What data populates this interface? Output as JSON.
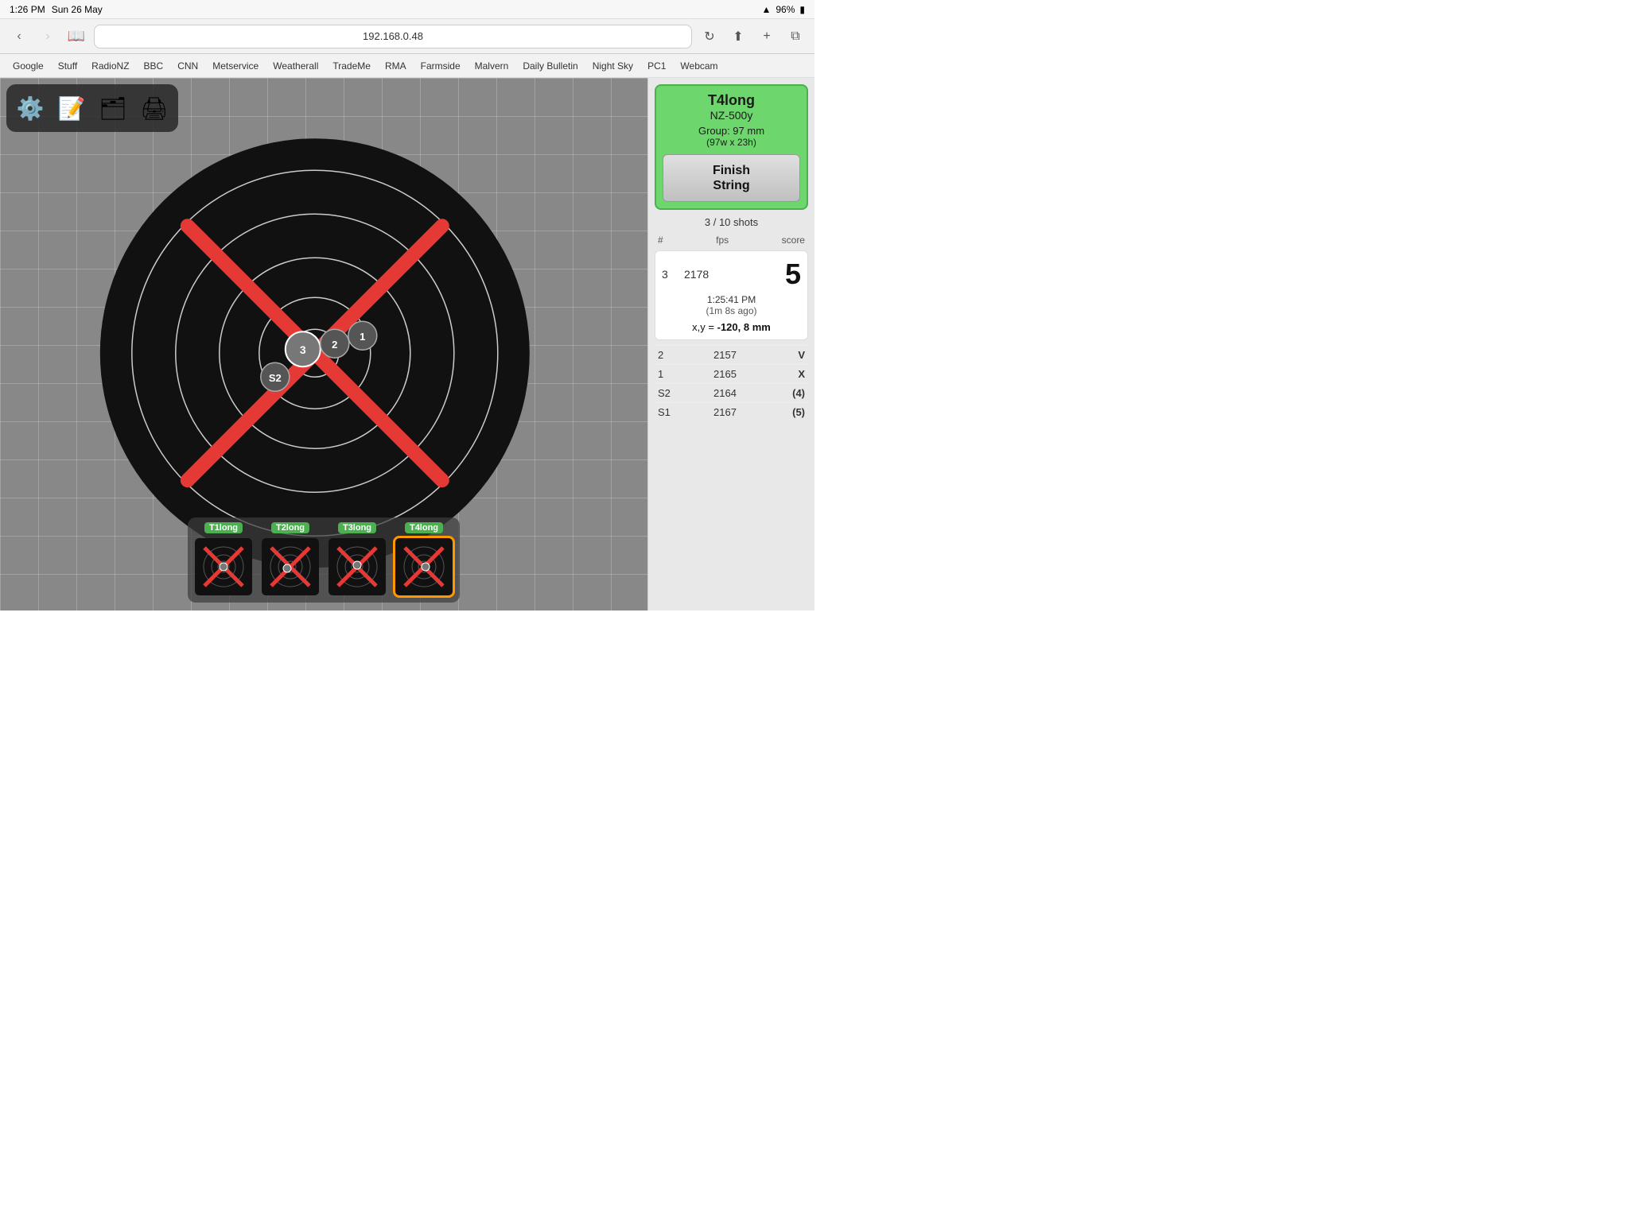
{
  "status_bar": {
    "time": "1:26 PM",
    "date": "Sun 26 May",
    "wifi_icon": "wifi",
    "battery": "96%",
    "battery_icon": "battery"
  },
  "browser": {
    "address": "192.168.0.48",
    "refresh_icon": "↻",
    "back_icon": "‹",
    "forward_icon": "›",
    "bookmarks_icon": "📖",
    "share_icon": "⬆",
    "new_tab_icon": "+",
    "tabs_icon": "⧉"
  },
  "bookmarks": [
    "Google",
    "Stuff",
    "RadioNZ",
    "BBC",
    "CNN",
    "Metservice",
    "Weatherall",
    "TradeMe",
    "RMA",
    "Farmside",
    "Malvern",
    "Daily Bulletin",
    "Night Sky",
    "PC1",
    "Webcam"
  ],
  "toolbar": {
    "settings_icon": "⚙",
    "notes_icon": "📝",
    "files_icon": "🗂",
    "print_icon": "🖨"
  },
  "target_info": {
    "name": "T4long",
    "distance": "NZ-500y",
    "group_label": "Group: 97 mm",
    "group_detail": "(97w x 23h)",
    "finish_string": "Finish\nString",
    "shots_count": "3 / 10 shots"
  },
  "shots_header": {
    "num": "#",
    "fps": "fps",
    "score": "score"
  },
  "current_shot": {
    "num": 3,
    "fps": 2178,
    "score": "5",
    "time": "1:25:41 PM",
    "ago": "(1m 8s ago)",
    "xy_label": "x,y =",
    "xy_value": "-120, 8 mm"
  },
  "history": [
    {
      "num": 2,
      "fps": 2157,
      "score": "V"
    },
    {
      "num": 1,
      "fps": 2165,
      "score": "X"
    },
    {
      "num": "S2",
      "fps": 2164,
      "score": "(4)"
    },
    {
      "num": "S1",
      "fps": 2167,
      "score": "(5)"
    }
  ],
  "thumbnails": [
    {
      "label": "T1long",
      "active": false
    },
    {
      "label": "T2long",
      "active": false
    },
    {
      "label": "T3long",
      "active": false
    },
    {
      "label": "T4long",
      "active": true
    }
  ]
}
